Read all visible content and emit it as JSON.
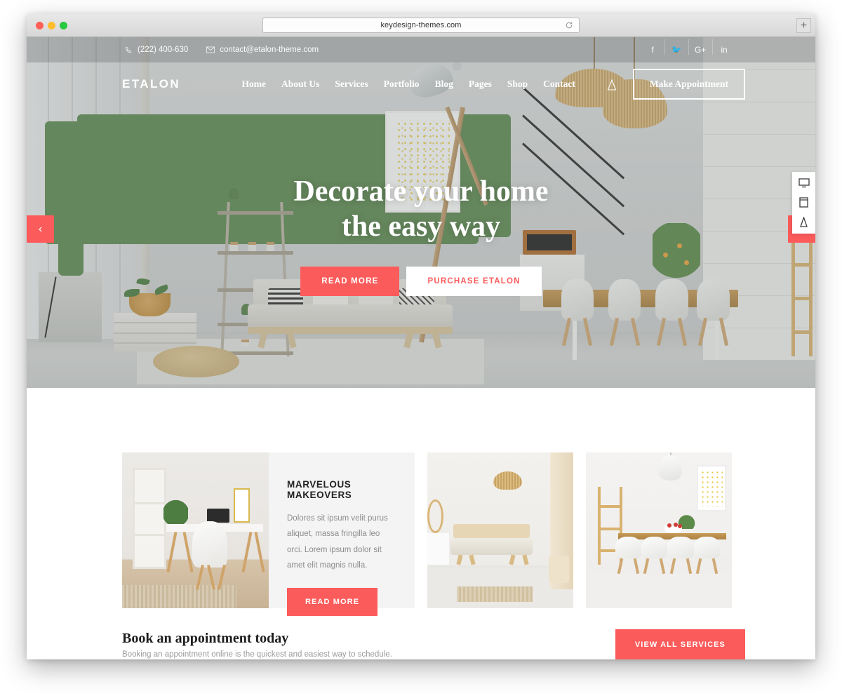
{
  "browser": {
    "url": "keydesign-themes.com",
    "reload_icon": "reload-icon",
    "newtab_label": "+"
  },
  "topbar": {
    "phone": "(222) 400-630",
    "email": "contact@etalon-theme.com",
    "social": [
      {
        "name": "facebook",
        "glyph": "f"
      },
      {
        "name": "twitter",
        "glyph": "🐦"
      },
      {
        "name": "google-plus",
        "glyph": "G+"
      },
      {
        "name": "linkedin",
        "glyph": "in"
      }
    ]
  },
  "nav": {
    "brand": "ETALON",
    "links": [
      "Home",
      "About Us",
      "Services",
      "Portfolio",
      "Blog",
      "Pages",
      "Shop",
      "Contact"
    ],
    "cart_icon": "shopping-bag-icon",
    "appointment_button": "Make Appointment"
  },
  "hero": {
    "title_line1": "Decorate your home",
    "title_line2": "the easy way",
    "primary_button": "READ MORE",
    "secondary_button": "PURCHASE ETALON",
    "prev_arrow": "‹",
    "next_arrow": "›"
  },
  "device_switcher": {
    "items": [
      "desktop-icon",
      "tablet-icon",
      "mobile-icon"
    ]
  },
  "cards": {
    "featured": {
      "title": "MARVELOUS MAKEOVERS",
      "text": "Dolores sit ipsum velit purus aliquet, massa fringilla leo orci. Lorem ipsum dolor sit amet elit magnis nulla.",
      "button": "READ MORE",
      "image_alt": "home-office-photo"
    },
    "tiles": [
      {
        "image_alt": "living-room-photo"
      },
      {
        "image_alt": "dining-room-photo"
      }
    ]
  },
  "appointment": {
    "title": "Book an appointment today",
    "subtitle": "Booking an appointment online is the quickest and easiest way to schedule.",
    "cta": "VIEW ALL SERVICES"
  },
  "colors": {
    "accent": "#fb5b5b",
    "card_bg": "#f4f4f4",
    "text_dark": "#1d1d1d",
    "text_muted": "#8d8d8d"
  }
}
